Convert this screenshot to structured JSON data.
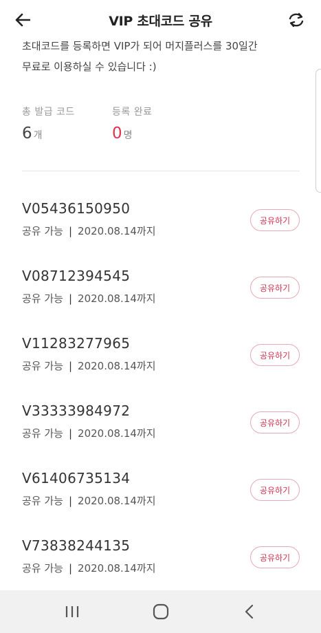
{
  "header": {
    "title": "VIP 초대코드 공유",
    "back_icon": "arrow-left-icon",
    "refresh_icon": "refresh-icon"
  },
  "intro": {
    "line1": "초대코드를 등록하면 VIP가 되어 머지플러스를 30일간",
    "line2": "무료로 이용하실 수 있습니다 :)"
  },
  "stats": {
    "issued": {
      "label": "총 발급 코드",
      "value": "6",
      "unit": "개"
    },
    "registered": {
      "label": "등록 완료",
      "value": "0",
      "unit": "명"
    }
  },
  "codes": [
    {
      "code": "V05436150950",
      "status": "공유 가능",
      "separator": "|",
      "expiry": "2020.08.14까지",
      "button": "공유하기"
    },
    {
      "code": "V08712394545",
      "status": "공유 가능",
      "separator": "|",
      "expiry": "2020.08.14까지",
      "button": "공유하기"
    },
    {
      "code": "V11283277965",
      "status": "공유 가능",
      "separator": "|",
      "expiry": "2020.08.14까지",
      "button": "공유하기"
    },
    {
      "code": "V33333984972",
      "status": "공유 가능",
      "separator": "|",
      "expiry": "2020.08.14까지",
      "button": "공유하기"
    },
    {
      "code": "V61406735134",
      "status": "공유 가능",
      "separator": "|",
      "expiry": "2020.08.14까지",
      "button": "공유하기"
    },
    {
      "code": "V73838244135",
      "status": "공유 가능",
      "separator": "|",
      "expiry": "2020.08.14까지",
      "button": "공유하기"
    }
  ],
  "navbar": {
    "recents_icon": "recents-icon",
    "home_icon": "home-icon",
    "back_icon": "nav-back-icon"
  },
  "colors": {
    "accent": "#e0334d",
    "button_border": "#e6aab5",
    "navbar_bg": "#f1f1f1"
  }
}
